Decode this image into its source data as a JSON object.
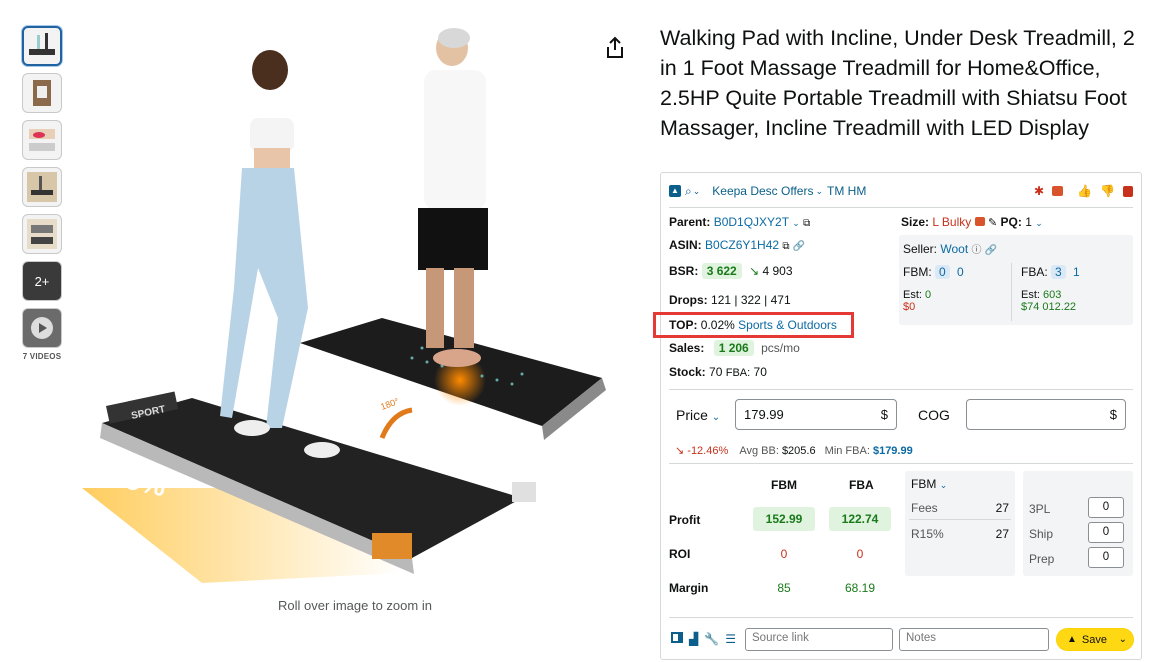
{
  "product": {
    "title": "Walking Pad with Incline, Under Desk Treadmill, 2 in 1 Foot Massage Treadmill for Home&Office, 2.5HP Quite Portable Treadmill with Shiatsu Foot Massager, Incline Treadmill with LED Display",
    "zoom_hint": "Roll over image to zoom in",
    "image_overlay": {
      "incline": "5%",
      "brand": "SPORT",
      "angle": "180°"
    },
    "thumbnails": {
      "more_label": "2+",
      "videos_label": "7 VIDEOS"
    }
  },
  "keepa": {
    "toolbar": {
      "title": "Keepa Desc Offers",
      "tm": "TM HM"
    },
    "parent": {
      "label": "Parent:",
      "value": "B0D1QJXY2T"
    },
    "asin": {
      "label": "ASIN:",
      "value": "B0CZ6Y1H42"
    },
    "bsr": {
      "label": "BSR:",
      "value": "3 622",
      "trend": "4 903"
    },
    "drops": {
      "label": "Drops:",
      "value": "121 | 322 | 471"
    },
    "top": {
      "label": "TOP:",
      "percent": "0.02%",
      "category": "Sports & Outdoors"
    },
    "sales": {
      "label": "Sales:",
      "value": "1 206",
      "unit": "pcs/mo"
    },
    "stock": {
      "label": "Stock:",
      "value": "70",
      "fba_label": "FBA:",
      "fba_value": "70"
    },
    "size": {
      "label": "Size:",
      "value": "L Bulky",
      "pq_label": "PQ:",
      "pq_value": "1"
    },
    "seller": {
      "label": "Seller:",
      "value": "Woot"
    },
    "fbm": {
      "label": "FBM:",
      "count1": "0",
      "count2": "0",
      "est_label": "Est:",
      "est_value": "0",
      "est_money": "$0"
    },
    "fba": {
      "label": "FBA:",
      "count1": "3",
      "count2": "1",
      "est_label": "Est:",
      "est_value": "603",
      "est_money": "$74 012.22"
    },
    "price": {
      "label": "Price",
      "value": "179.99",
      "currency": "$",
      "cog_label": "COG",
      "cog_currency": "$"
    },
    "price_stats": {
      "change": "-12.46%",
      "avg_bb_label": "Avg BB:",
      "avg_bb": "$205.6",
      "min_fba_label": "Min FBA:",
      "min_fba": "$179.99"
    },
    "calc": {
      "col_fbm": "FBM",
      "col_fba": "FBA",
      "profit_label": "Profit",
      "profit_fbm": "152.99",
      "profit_fba": "122.74",
      "roi_label": "ROI",
      "roi_fbm": "0",
      "roi_fba": "0",
      "margin_label": "Margin",
      "margin_fbm": "85",
      "margin_fba": "68.19"
    },
    "fees": {
      "mode": "FBM",
      "fees_label": "Fees",
      "fees_value": "27",
      "r15_label": "R15%",
      "r15_value": "27"
    },
    "misc": {
      "tpl_label": "3PL",
      "tpl_value": "0",
      "ship_label": "Ship",
      "ship_value": "0",
      "prep_label": "Prep",
      "prep_value": "0"
    },
    "footer": {
      "source_placeholder": "Source link",
      "notes_placeholder": "Notes",
      "save_label": "Save"
    }
  },
  "colors": {
    "accent_blue": "#0b6aa3",
    "profit_green": "#1a7a1a",
    "loss_red": "#c7311b",
    "highlight_red": "#e53935",
    "save_yellow": "#ffd814"
  }
}
